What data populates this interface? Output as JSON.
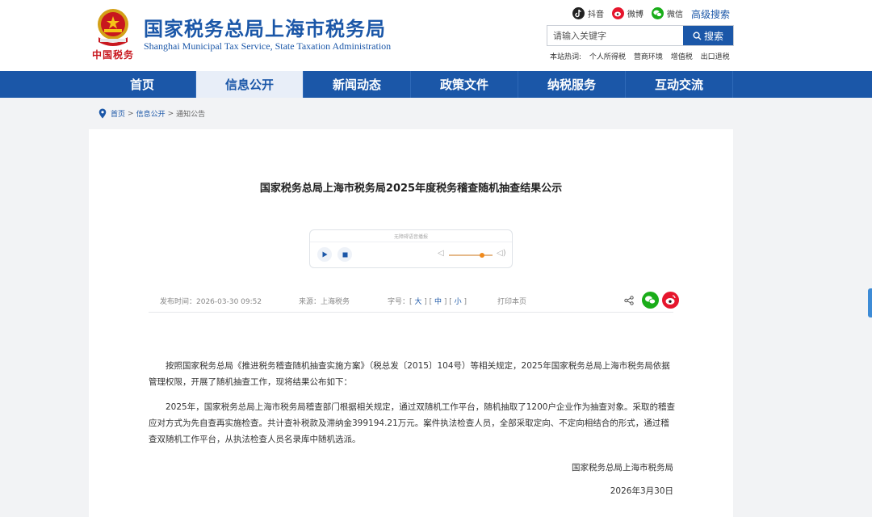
{
  "header": {
    "title": "国家税务总局上海市税务局",
    "subtitle": "Shanghai Municipal Tax Service, State Taxation Administration",
    "logo_text": "中国税务"
  },
  "social": {
    "douyin": "抖音",
    "weibo": "微博",
    "weixin": "微信",
    "advanced_search": "高级搜索"
  },
  "search": {
    "placeholder": "请输入关键字",
    "button": "搜索",
    "hot_label": "本站热词:",
    "hot_words": [
      "个人所得税",
      "营商环境",
      "增值税",
      "出口退税"
    ]
  },
  "nav": {
    "items": [
      "首页",
      "信息公开",
      "新闻动态",
      "政策文件",
      "纳税服务",
      "互动交流"
    ],
    "active_index": 1
  },
  "breadcrumb": {
    "home": "首页",
    "level2": "信息公开",
    "current": "通知公告",
    "separator": ">"
  },
  "article": {
    "title": "国家税务总局上海市税务局2025年度税务稽查随机抽查结果公示",
    "player_caption": "无障碍语音播报",
    "meta": {
      "publish_time": "发布时间：2026-03-30 09:52",
      "source": "来源：上海税务",
      "font_label": "字号：",
      "font_large": "大",
      "font_medium": "中",
      "font_small": "小",
      "print": "打印本页"
    },
    "paragraphs": [
      "按照国家税务总局《推进税务稽查随机抽查实施方案》（税总发〔2015〕104号）等相关规定，2025年国家税务总局上海市税务局依据管理权限，开展了随机抽查工作，现将结果公布如下：",
      "2025年，国家税务总局上海市税务局稽查部门根据相关规定，通过双随机工作平台，随机抽取了1200户企业作为抽查对象。采取的稽查应对方式为先自查再实施检查。共计查补税款及滞纳金399194.21万元。案件执法检查人员，全部采取定向、不定向相结合的形式，通过稽查双随机工作平台，从执法检查人员名录库中随机选派。"
    ],
    "signature": "国家税务总局上海市税务局",
    "date": "2026年3月30日"
  },
  "colors": {
    "brand": "#1b57a8",
    "accent_red": "#c8171e",
    "weixin_green": "#1aad19",
    "weibo_red": "#e6162d"
  }
}
